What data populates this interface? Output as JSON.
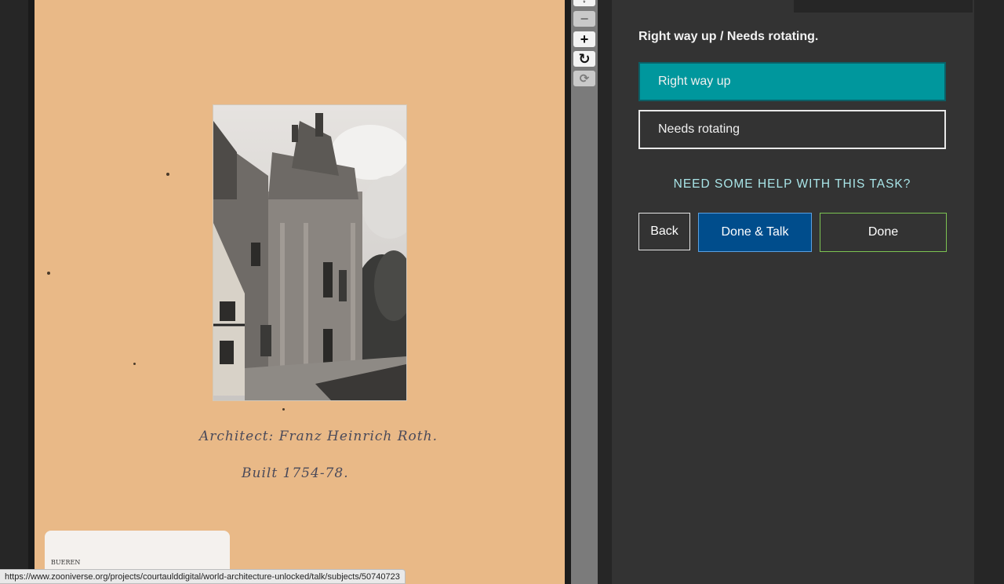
{
  "viewer": {
    "handwriting_line1": "Architect: Franz Heinrich Roth.",
    "handwriting_line2": "Built 1754-78.",
    "index_card_text": "BUEREN"
  },
  "controls": {
    "zoom_in": "+",
    "zoom_out": "−",
    "rotate": "↻",
    "reset": "⟳"
  },
  "task": {
    "question": "Right way up / Needs rotating.",
    "answers": [
      {
        "label": "Right way up",
        "selected": true
      },
      {
        "label": "Needs rotating",
        "selected": false
      }
    ],
    "help_link": "NEED SOME HELP WITH THIS TASK?"
  },
  "buttons": {
    "back": "Back",
    "done_talk": "Done & Talk",
    "done": "Done"
  },
  "status_bar": {
    "url": "https://www.zooniverse.org/projects/courtaulddigital/world-architecture-unlocked/talk/subjects/50740723"
  },
  "colors": {
    "selected_answer": "#00979d",
    "done_talk": "#004d8c",
    "done_border": "#7cc452",
    "help_text": "#a9e5e8",
    "paper": "#e9b987"
  }
}
